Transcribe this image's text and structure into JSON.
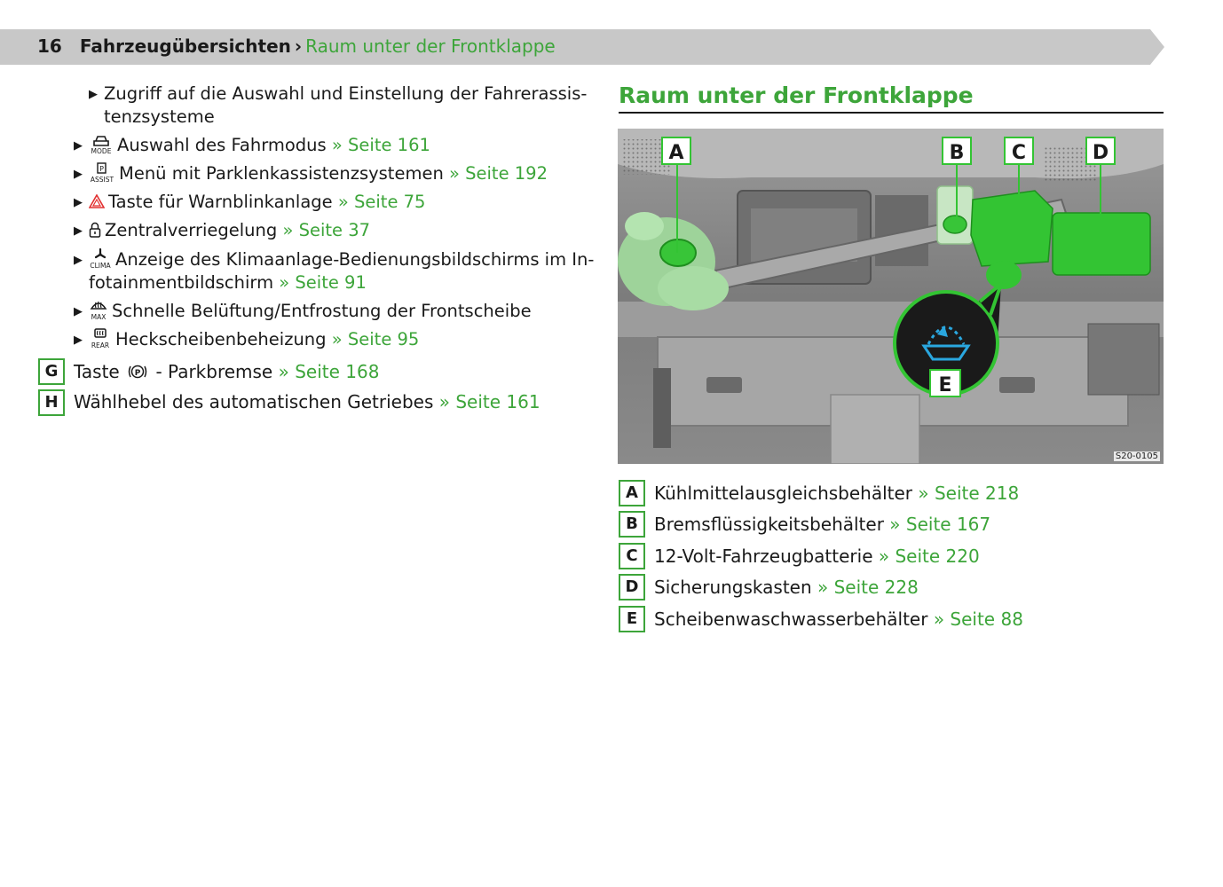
{
  "header": {
    "page_number": "16",
    "section": "Fahrzeugübersichten",
    "separator": "›",
    "subsection": "Raum unter der Frontklappe"
  },
  "left": {
    "sub_bullet": {
      "line1": "Zugriff auf die Auswahl und Einstellung der Fahrerassis-",
      "line2": "tenzsysteme"
    },
    "bullets": [
      {
        "symbol_label": "MODE",
        "icon": "car-mode-icon",
        "text": "Auswahl des Fahrmodus",
        "ref": "» Seite 161"
      },
      {
        "symbol_label": "ASSIST",
        "icon": "park-assist-icon",
        "text": "Menü mit Parklenkassistenzsystemen",
        "ref": "» Seite 192"
      },
      {
        "icon": "hazard-triangle-icon",
        "text": "Taste für Warnblinkanlage",
        "ref": "» Seite 75"
      },
      {
        "icon": "lock-icon",
        "text": "Zentralverriegelung",
        "ref": "» Seite 37"
      },
      {
        "symbol_label": "CLIMA",
        "icon": "fan-icon",
        "text": "Anzeige des Klimaanlage-Bedienungsbildschirms im In-",
        "text2": "fotainmentbildschirm",
        "ref": "» Seite 91"
      },
      {
        "symbol_label": "MAX",
        "icon": "windshield-defrost-icon",
        "text": "Schnelle Belüftung/Entfrostung der Frontscheibe"
      },
      {
        "symbol_label": "REAR",
        "icon": "rear-window-heat-icon",
        "text": "Heckscheibenbeheizung",
        "ref": "» Seite 95"
      }
    ],
    "items": [
      {
        "letter": "G",
        "text_before": "Taste",
        "icon": "parking-brake-icon",
        "text_after": "- Parkbremse",
        "ref": "» Seite 168"
      },
      {
        "letter": "H",
        "text": "Wählhebel des automatischen Getriebes",
        "ref": "» Seite 161"
      }
    ]
  },
  "right": {
    "title": "Raum unter der Frontklappe",
    "figure": {
      "code": "S20-0105",
      "callouts": [
        "A",
        "B",
        "C",
        "D",
        "E"
      ]
    },
    "legend": [
      {
        "letter": "A",
        "text": "Kühlmittelausgleichsbehälter",
        "ref": "» Seite 218"
      },
      {
        "letter": "B",
        "text": "Bremsflüssigkeitsbehälter",
        "ref": "» Seite 167"
      },
      {
        "letter": "C",
        "text": "12-Volt-Fahrzeugbatterie",
        "ref": "» Seite 220"
      },
      {
        "letter": "D",
        "text": "Sicherungskasten",
        "ref": "» Seite 228"
      },
      {
        "letter": "E",
        "text": "Scheibenwaschwasserbehälter",
        "ref": "» Seite 88"
      }
    ]
  },
  "colors": {
    "accent_green": "#3da53a",
    "highlight_green": "#33c433",
    "header_band": "#c8c8c8",
    "washer_blue": "#2aa7df"
  }
}
